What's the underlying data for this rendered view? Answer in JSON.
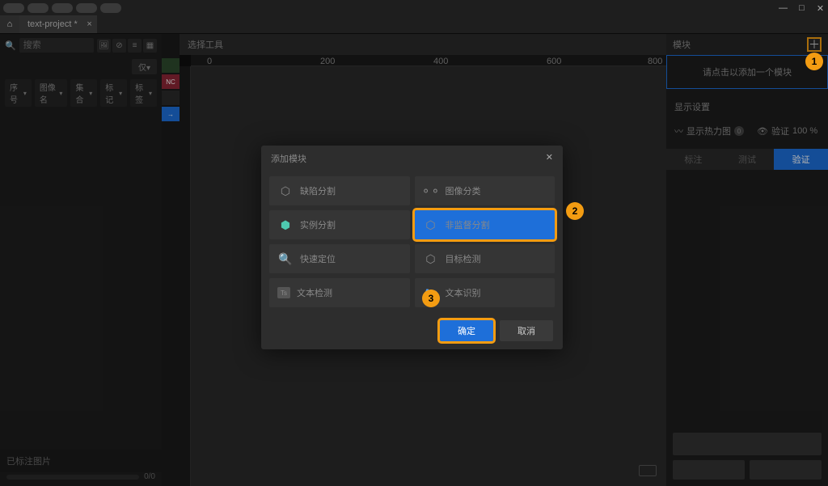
{
  "window": {
    "title": "text-project *"
  },
  "search": {
    "placeholder": "搜索"
  },
  "left": {
    "filter_btn": "仅▾",
    "headers": [
      "序号",
      "图像名",
      "集合",
      "标记",
      "标签"
    ],
    "status": "已标注图片",
    "progress": "0/0"
  },
  "gutter": {
    "a": "",
    "b": "NC",
    "c": "→"
  },
  "center": {
    "toolbar_title": "选择工具",
    "ticks": [
      "0",
      "200",
      "400",
      "600",
      "800"
    ]
  },
  "right": {
    "title": "模块",
    "empty_text": "请点击以添加一个模块",
    "display_section": "显示设置",
    "heatmap": "显示热力图",
    "heatmap_badge": "0",
    "verify": "验证",
    "verify_val": "100 %",
    "tabs": [
      "标注",
      "测试",
      "验证"
    ]
  },
  "modal": {
    "title": "添加模块",
    "items": [
      {
        "label": "缺陷分割"
      },
      {
        "label": "图像分类"
      },
      {
        "label": "实例分割"
      },
      {
        "label": "非监督分割"
      },
      {
        "label": "快速定位"
      },
      {
        "label": "目标检测"
      },
      {
        "label": "文本检测"
      },
      {
        "label": "文本识别"
      }
    ],
    "ok": "确定",
    "cancel": "取消"
  },
  "anno": {
    "n1": "1",
    "n2": "2",
    "n3": "3"
  }
}
